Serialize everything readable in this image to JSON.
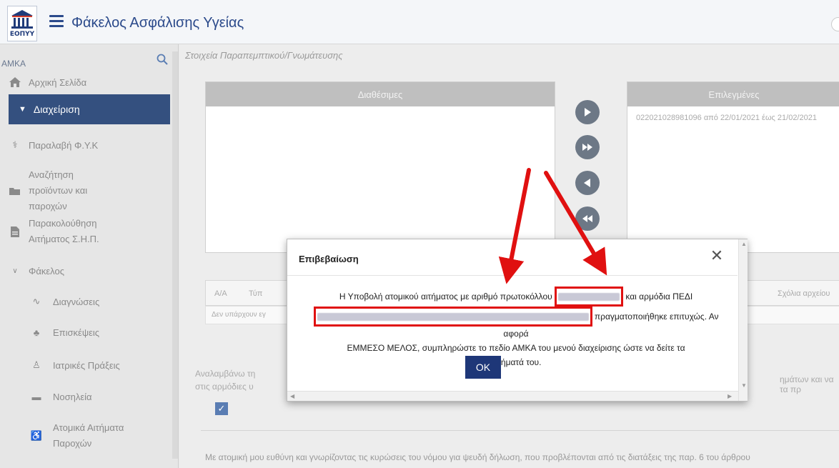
{
  "header": {
    "logo_text": "ΕΟΠΥΥ",
    "title": "Φάκελος Ασφάλισης Υγείας"
  },
  "sidebar": {
    "amka_label": "ΑΜΚΑ",
    "home": "Αρχική Σελίδα",
    "active_section": "Διαχείριση",
    "items": [
      {
        "label": "Παραλαβή Φ.Υ.Κ",
        "icon": "caduceus-icon"
      },
      {
        "label": "Αναζήτηση προϊόντων και παροχών",
        "icon": "folder-open-icon"
      },
      {
        "label": "Παρακολούθηση Αιτήματος Σ.Η.Π.",
        "icon": "file-icon"
      }
    ],
    "folder_group": "Φάκελος",
    "sub_items": [
      {
        "label": "Διαγνώσεις",
        "icon": "heartbeat-icon"
      },
      {
        "label": "Επισκέψεις",
        "icon": "visit-icon"
      },
      {
        "label": "Ιατρικές Πράξεις",
        "icon": "medical-act-icon"
      },
      {
        "label": "Νοσηλεία",
        "icon": "bed-icon"
      },
      {
        "label": "Ατομικά Αιτήματα Παροχών",
        "icon": "wheelchair-icon"
      }
    ]
  },
  "main": {
    "section_title": "Στοιχεία Παραπεμπτικού/Γνωμάτευσης",
    "available_header": "Διαθέσιμες",
    "selected_header": "Επιλεγμένες",
    "selected_entry": "022021028981096 από 22/01/2021 έως 21/02/2021",
    "table": {
      "col1": "Α/Α",
      "col2": "Τύπ",
      "col3": "Σχόλια αρχείου",
      "empty": "Δεν υπάρχουν εγ"
    },
    "declaration_start": "Αναλαμβάνω τη",
    "declaration_line2": "στις αρμόδιες υ",
    "declaration_end": "ημάτων και να τα πρ",
    "bottom_text": "Με ατομική μου ευθύνη και γνωρίζοντας τις κυρώσεις του νόμου για ψευδή δήλωση, που προβλέπονται από τις διατάξεις της παρ. 6 του άρθρου"
  },
  "modal": {
    "title": "Επιβεβαίωση",
    "close": "✕",
    "body_1": "Η Υποβολή ατομικού αιτήματος με αριθμό πρωτοκόλλου",
    "body_2": "και αρμόδια ΠΕΔΙ",
    "body_3": "πραγματοποιήθηκε επιτυχώς. Αν αφορά",
    "body_4": "ΕΜΜΕΣΟ ΜΕΛΟΣ, συμπληρώστε το πεδίο ΑΜΚΑ του μενού διαχείρισης ώστε να δείτε τα",
    "body_5": "αιτήματά του.",
    "ok_label": "OK"
  },
  "colors": {
    "accent": "#1e3778",
    "sidebar_active": "#34507f",
    "annotation": "#e01010"
  }
}
